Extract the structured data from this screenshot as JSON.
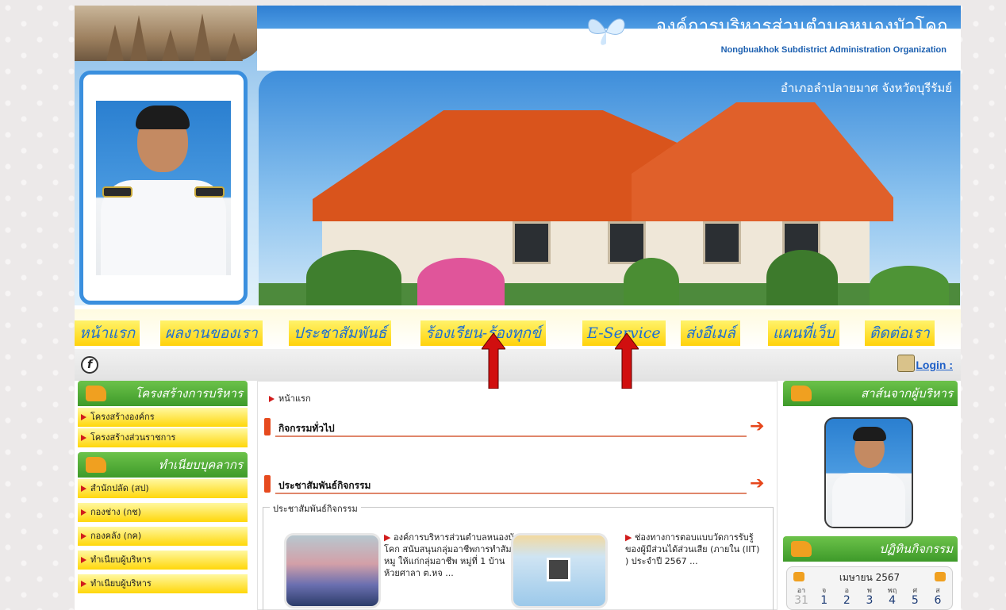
{
  "header": {
    "org_name_th": "องค์การบริหารส่วนตำบลหนองบัวโคก",
    "org_name_en": "Nongbuakhok Subdistrict Administration Organization",
    "district": "อำเภอลำปลายมาศ จังหวัดบุรีรัมย์"
  },
  "nav": {
    "items": [
      {
        "label": "หน้าแรก"
      },
      {
        "label": "ผลงานของเรา"
      },
      {
        "label": "ประชาสัมพันธ์"
      },
      {
        "label": "ร้องเรียน-ร้องทุกข์"
      },
      {
        "label": "E-Service"
      },
      {
        "label": "ส่งอีเมล์"
      },
      {
        "label": "แผนที่เว็บ"
      },
      {
        "label": "ติดต่อเรา"
      }
    ]
  },
  "subbar": {
    "flash_glyph": "f",
    "login_label": "Login :"
  },
  "left": {
    "section1_title": "โครงสร้างการบริหาร",
    "section1_items": [
      "โครงสร้างองค์กร",
      "โครงสร้างส่วนราชการ"
    ],
    "section2_title": "ทำเนียบบุคลากร",
    "section2_items": [
      "สำนักปลัด (สป)",
      "กองช่าง (กช)",
      "กองคลัง (กค)",
      "ทำเนียบผู้บริหาร",
      "ทำเนียบผู้บริหาร"
    ]
  },
  "center": {
    "breadcrumb": "หน้าแรก",
    "section1_title": "กิจกรรมทั่วไป",
    "section2_title": "ประชาสัมพันธ์กิจกรรม",
    "fieldset_legend": "ประชาสัมพันธ์กิจกรรม",
    "news": [
      {
        "text": "องค์การบริหารส่วนตำบลหนองบัวโคก สนับสนุนกลุ่มอาชีพการทำสัมหมู ให้แก่กลุ่มอาชีพ หมู่ที่ 1 บ้านห้วยศาลา ต.หจ ..."
      },
      {
        "text": "ช่องทางการตอบแบบวัดการรับรู้ของผู้มีส่วนได้ส่วนเสีย (ภายใน (IIT) ) ประจำปี 2567 ..."
      }
    ]
  },
  "right": {
    "section1_title": "สาส์นจากผู้บริหาร",
    "section2_title": "ปฏิทินกิจกรรม",
    "calendar": {
      "month": "เมษายน 2567",
      "weekdays": [
        "อา",
        "จ",
        "อ",
        "พ",
        "พฤ",
        "ศ",
        "ส"
      ],
      "days": [
        "31",
        "1",
        "2",
        "3",
        "4",
        "5",
        "6"
      ]
    }
  },
  "colors": {
    "accent_blue": "#1f6fd0",
    "nav_yellow": "#ffd20a",
    "sidebar_green": "#3e9a2a",
    "annotation_red": "#d10f0f"
  }
}
